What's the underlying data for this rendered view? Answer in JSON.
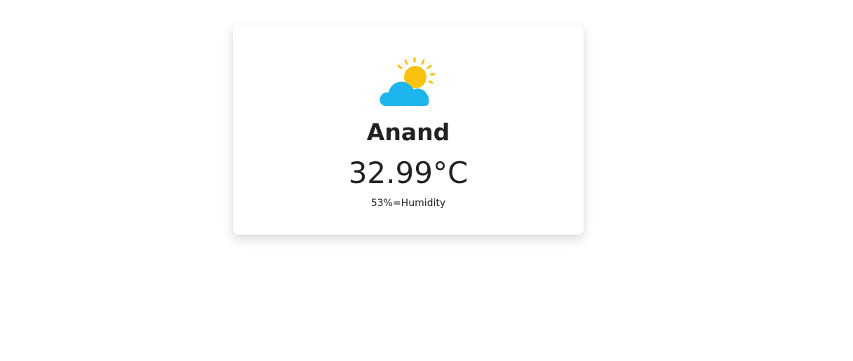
{
  "weather": {
    "icon": "partly-cloudy-icon",
    "city": "Anand",
    "temperature": "32.99°C",
    "humidity": "53%=Humidity"
  },
  "colors": {
    "sun": "#F9C20F",
    "cloud": "#1DB5EE",
    "text": "#222222",
    "card_background": "#FFFFFF"
  }
}
